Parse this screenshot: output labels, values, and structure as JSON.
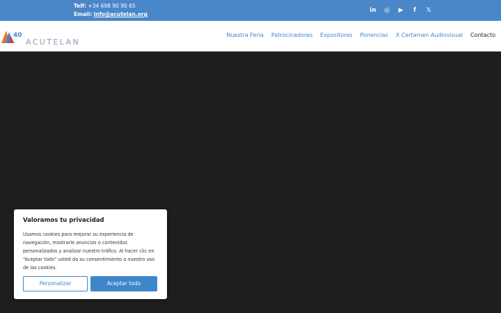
{
  "topbar": {
    "phone_label": "Telf:",
    "phone": "+34 698 90 90 65",
    "email_label": "Email:",
    "email": "info@acutelan.org",
    "social": [
      {
        "icon": "linkedin-icon",
        "glyph": "in"
      },
      {
        "icon": "instagram-icon",
        "glyph": "◎"
      },
      {
        "icon": "youtube-icon",
        "glyph": "▶"
      },
      {
        "icon": "facebook-icon",
        "glyph": "f"
      },
      {
        "icon": "x-icon",
        "glyph": "𝕏"
      }
    ]
  },
  "header": {
    "logo_number": "40",
    "logo_text": "ACUTELAN",
    "nav": [
      "Nuestra Feria",
      "Patrocinadores",
      "Expositores",
      "Ponencias",
      "X Certamen Audiovisual",
      "Contacto"
    ]
  },
  "cookie": {
    "title": "Valoramos tu privacidad",
    "body": "Usamos cookies para mejorar su experiencia de navegación, mostrarle anuncios o contenidos personalizados y analizar nuestro tráfico. Al hacer clic en “Aceptar todo” usted da su consentimiento a nuestro uso de las cookies.",
    "customize_label": "Personalizar",
    "accept_label": "Aceptar todo"
  },
  "colors": {
    "brand_blue": "#4a87c9",
    "link_blue": "#3d86c9",
    "hero_bg": "#1e1e1e"
  }
}
